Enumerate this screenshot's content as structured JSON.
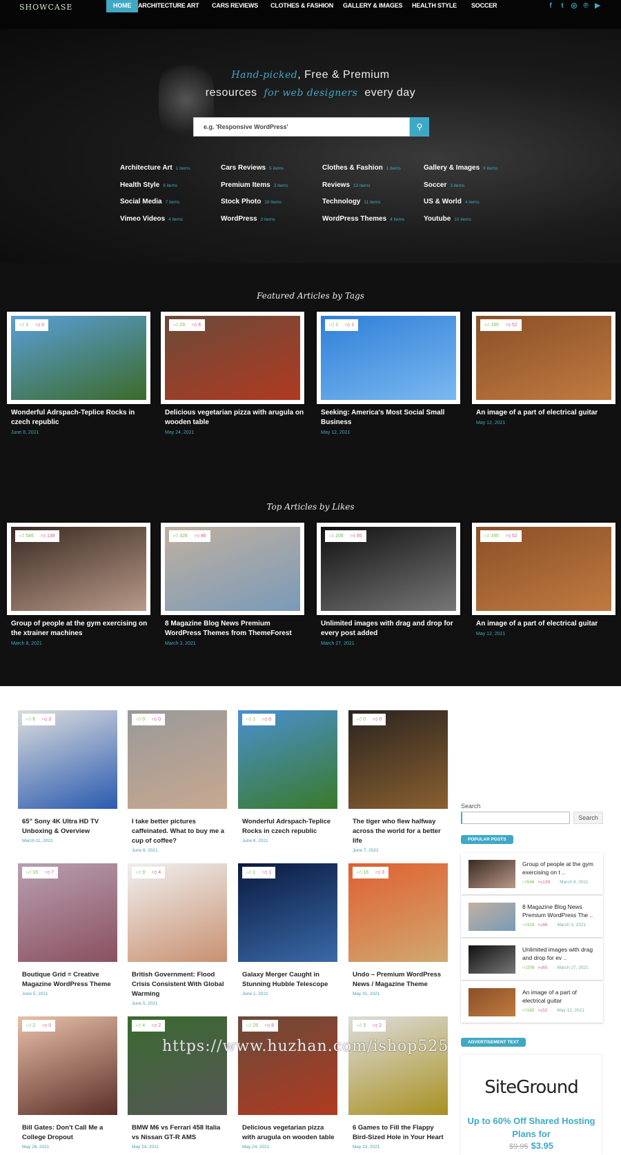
{
  "header": {
    "logo": "SHOWCASE",
    "nav": [
      "HOME",
      "ARCHITECTURE ART",
      "CARS REVIEWS",
      "CLOTHES & FASHION",
      "GALLERY & IMAGES",
      "HEALTH STYLE",
      "SOCCER"
    ],
    "active": "HOME",
    "social": [
      "facebook-icon",
      "twitter-icon",
      "instagram-icon",
      "pinterest-icon",
      "youtube-icon"
    ]
  },
  "hero": {
    "line1_script": "Hand-picked",
    "line1_rest": ", Free & Premium",
    "line2_start": "resources",
    "line2_script": "for web designers",
    "line2_end": "every day",
    "search_placeholder": "e.g. 'Responsive WordPress'",
    "categories": [
      {
        "name": "Architecture Art",
        "count": "1 items"
      },
      {
        "name": "Cars Reviews",
        "count": "5 items"
      },
      {
        "name": "Clothes & Fashion",
        "count": "1 items"
      },
      {
        "name": "Gallery & Images",
        "count": "9 items"
      },
      {
        "name": "Health Style",
        "count": "8 items"
      },
      {
        "name": "Premium Items",
        "count": "3 items"
      },
      {
        "name": "Reviews",
        "count": "13 items"
      },
      {
        "name": "Soccer",
        "count": "3 items"
      },
      {
        "name": "Social Media",
        "count": "7 items"
      },
      {
        "name": "Stock Photo",
        "count": "28 items"
      },
      {
        "name": "Technology",
        "count": "11 items"
      },
      {
        "name": "US & World",
        "count": "4 items"
      },
      {
        "name": "Vimeo Videos",
        "count": "4 items"
      },
      {
        "name": "WordPress",
        "count": "3 items"
      },
      {
        "name": "WordPress Themes",
        "count": "4 items"
      },
      {
        "name": "Youtube",
        "count": "10 items"
      }
    ]
  },
  "featured": {
    "title": "Featured Articles by Tags",
    "items": [
      {
        "likes": "1",
        "dislikes": "0",
        "title": "Wonderful Adrspach-Teplice Rocks in czech republic",
        "date": "June 8, 2021",
        "colors": [
          "#5a9fd8",
          "#3c6b2a"
        ]
      },
      {
        "likes": "29",
        "dislikes": "8",
        "title": "Delicious vegetarian pizza with arugula on wooden table",
        "date": "May 24, 2021",
        "colors": [
          "#6b4a3a",
          "#b03a20"
        ]
      },
      {
        "likes": "2",
        "dislikes": "1",
        "title": "Seeking: America's Most Social Small Business",
        "date": "May 12, 2021",
        "colors": [
          "#2f7fd8",
          "#7ab8f0"
        ]
      },
      {
        "likes": "165",
        "dislikes": "52",
        "title": "An image of a part of electrical guitar",
        "date": "May 12, 2021",
        "colors": [
          "#8a5028",
          "#c07a40"
        ]
      }
    ]
  },
  "top": {
    "title": "Top Articles by Likes",
    "items": [
      {
        "likes": "546",
        "dislikes": "139",
        "title": "Group of people at the gym exercising on the xtrainer machines",
        "date": "March 8, 2021",
        "colors": [
          "#3a2a22",
          "#b89a88"
        ]
      },
      {
        "likes": "328",
        "dislikes": "86",
        "title": "8 Magazine Blog News Premium WordPress Themes from ThemeForest",
        "date": "March 3, 2021",
        "colors": [
          "#c0b0a0",
          "#7a9ab8"
        ]
      },
      {
        "likes": "206",
        "dislikes": "65",
        "title": "Unlimited images with drag and drop for every post added",
        "date": "March 27, 2021",
        "colors": [
          "#111",
          "#777"
        ]
      },
      {
        "likes": "165",
        "dislikes": "52",
        "title": "An image of a part of electrical guitar",
        "date": "May 12, 2021",
        "colors": [
          "#8a5028",
          "#c07a40"
        ]
      }
    ]
  },
  "grid": [
    {
      "likes": "6",
      "dislikes": "3",
      "title": "65\" Sony 4K Ultra HD TV Unboxing & Overview",
      "date": "March 11, 2021",
      "colors": [
        "#ddd",
        "#2a5ab0"
      ]
    },
    {
      "likes": "0",
      "dislikes": "0",
      "title": "I take better pictures caffeinated. What to buy me a cup of coffee?",
      "date": "June 9, 2021",
      "colors": [
        "#999",
        "#c8a890"
      ]
    },
    {
      "likes": "1",
      "dislikes": "0",
      "title": "Wonderful Adrspach-Teplice Rocks in czech republic",
      "date": "June 8, 2021",
      "colors": [
        "#4a90d0",
        "#3a7a2a"
      ]
    },
    {
      "likes": "0",
      "dislikes": "0",
      "title": "The tiger who flew halfway across the world for a better life",
      "date": "June 7, 2021",
      "colors": [
        "#2a2420",
        "#8a6030"
      ]
    },
    {
      "likes": "19",
      "dislikes": "7",
      "title": "Boutique Grid = Creative Magazine WordPress Theme",
      "date": "June 5, 2021",
      "colors": [
        "#b8a0b0",
        "#8a5060"
      ]
    },
    {
      "likes": "9",
      "dislikes": "4",
      "title": "British Government: Flood Crisis Consistent With Global Warming",
      "date": "June 5, 2021",
      "colors": [
        "#f0f0f0",
        "#c89070"
      ]
    },
    {
      "likes": "1",
      "dislikes": "1",
      "title": "Galaxy Merger Caught in Stunning Hubble Telescope",
      "date": "June 1, 2021",
      "colors": [
        "#0a1a40",
        "#3a6aa8"
      ]
    },
    {
      "likes": "16",
      "dislikes": "3",
      "title": "Undo – Premium WordPress News / Magazine Theme",
      "date": "May 31, 2021",
      "colors": [
        "#e06030",
        "#d0a870"
      ]
    },
    {
      "likes": "2",
      "dislikes": "0",
      "title": "Bill Gates: Don't Call Me a College Dropout",
      "date": "May 28, 2021",
      "colors": [
        "#e8c0a8",
        "#5a3028"
      ]
    },
    {
      "likes": "4",
      "dislikes": "2",
      "title": "BMW M6 vs Ferrari 458 Italia vs Nissan GT-R AMS",
      "date": "May 24, 2021",
      "colors": [
        "#3a6a30",
        "#555"
      ]
    },
    {
      "likes": "29",
      "dislikes": "8",
      "title": "Delicious vegetarian pizza with arugula on wooden table",
      "date": "May 24, 2021",
      "colors": [
        "#6b4a3a",
        "#b03a20"
      ]
    },
    {
      "likes": "3",
      "dislikes": "2",
      "title": "6 Games to Fill the Flappy Bird-Sized Hole in Your Heart",
      "date": "May 23, 2021",
      "colors": [
        "#ddd",
        "#a89020"
      ]
    }
  ],
  "sidebar": {
    "search_label": "Search",
    "search_button": "Search",
    "popular_title": "POPULAR POSTS",
    "popular": [
      {
        "title": "Group of people at the gym exercising on t ..",
        "likes": "546",
        "dislikes": "139",
        "date": "March 8, 2021",
        "colors": [
          "#3a2a22",
          "#b89a88"
        ]
      },
      {
        "title": "8 Magazine Blog News Premium WordPress The ..",
        "likes": "328",
        "dislikes": "86",
        "date": "March 3, 2021",
        "colors": [
          "#c0b0a0",
          "#7a9ab8"
        ]
      },
      {
        "title": "Unlimited images with drag and drop for ev ..",
        "likes": "206",
        "dislikes": "65",
        "date": "March 27, 2021",
        "colors": [
          "#111",
          "#777"
        ]
      },
      {
        "title": "An image of a part of electrical guitar",
        "likes": "165",
        "dislikes": "52",
        "date": "May 12, 2021",
        "colors": [
          "#8a5028",
          "#c07a40"
        ]
      }
    ],
    "ad_title": "ADVERTISEMENT TEXT",
    "ad": {
      "logo": "SiteGround",
      "text": "Up to 60% Off Shared Hosting Plans for",
      "old_price": "$9.95",
      "price": "$3.95"
    }
  },
  "watermark": "https://www.huzhan.com/ishop525",
  "colors": {
    "accent": "#3fa9c5",
    "like": "#7ab850",
    "dislike": "#d06090"
  }
}
